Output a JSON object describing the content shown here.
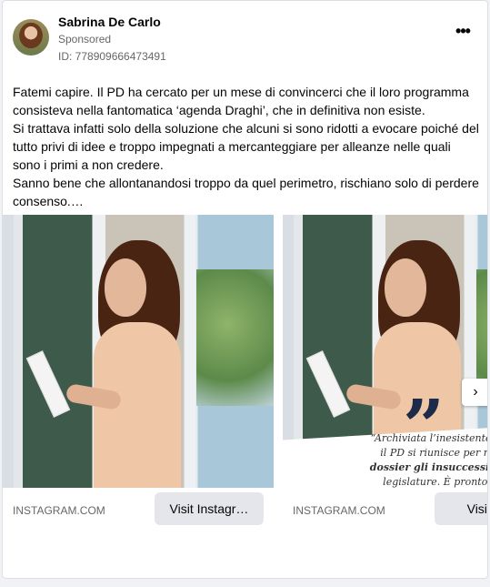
{
  "post": {
    "author": "Sabrina De Carlo",
    "sponsored_label": "Sponsored",
    "ad_id": "ID: 778909666473491",
    "more_icon": "more-horizontal-icon",
    "text": "Fatemi capire. Il PD ha cercato per un mese di convincerci che il loro programma consisteva nella fantomatica ‘agenda Draghi’, che in definitiva non esiste.\nSi trattava infatti solo della soluzione che alcuni si sono ridotti a evocare poiché del tutto privi di idee e troppo impegnati a mercanteggiare per alleanze nelle quali sono i primi a non credere.\nSanno bene che allontanandosi troppo da quel perimetro, rischiano solo di perdere consenso.…"
  },
  "carousel": {
    "cards": [
      {
        "domain": "INSTAGRAM.COM",
        "cta": "Visit Instagr…"
      },
      {
        "domain": "INSTAGRAM.COM",
        "cta": "Visit Ins",
        "quote_lines": [
          "“Archiviata l’inesistente agenda Dra",
          "il PD si riunisce per raccogliere in",
          "dossier gli insuccessi delle ultim",
          "legislature. È pronto il programm"
        ]
      }
    ],
    "next_icon": "chevron-right-icon"
  }
}
